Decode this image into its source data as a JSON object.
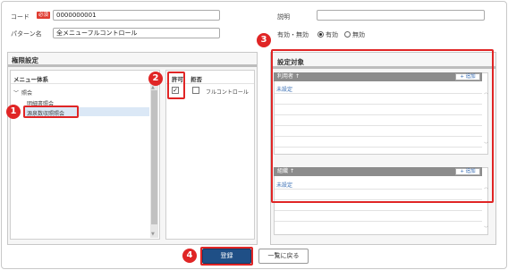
{
  "form": {
    "code_label": "コード",
    "required_badge": "必須",
    "code_value": "0000000001",
    "pattern_label": "パターン名",
    "pattern_value": "全メニューフルコントロール",
    "desc_label": "説明",
    "desc_value": "",
    "valid_label": "有効・無効",
    "valid_option": "有効",
    "invalid_option": "無効"
  },
  "perm_panel": {
    "title": "権限設定",
    "menu_header": "メニュー体系",
    "allow_header": "許可",
    "deny_header": "拒否",
    "tree": {
      "parent": "照会",
      "child1": "明細書照会",
      "child2": "源泉数収照照会"
    },
    "full_control_label": "フルコントロール"
  },
  "target_panel": {
    "title": "設定対象",
    "users_header": "利用者",
    "add_label": "追加",
    "not_set": "未設定",
    "org_header": "組織"
  },
  "buttons": {
    "register": "登録",
    "back": "一覧に戻る"
  },
  "callouts": {
    "n1": "1",
    "n2": "2",
    "n3": "3",
    "n4": "4"
  },
  "colors": {
    "callout": "#e02525",
    "primary": "#1f4f86",
    "link": "#3a6fb5"
  }
}
